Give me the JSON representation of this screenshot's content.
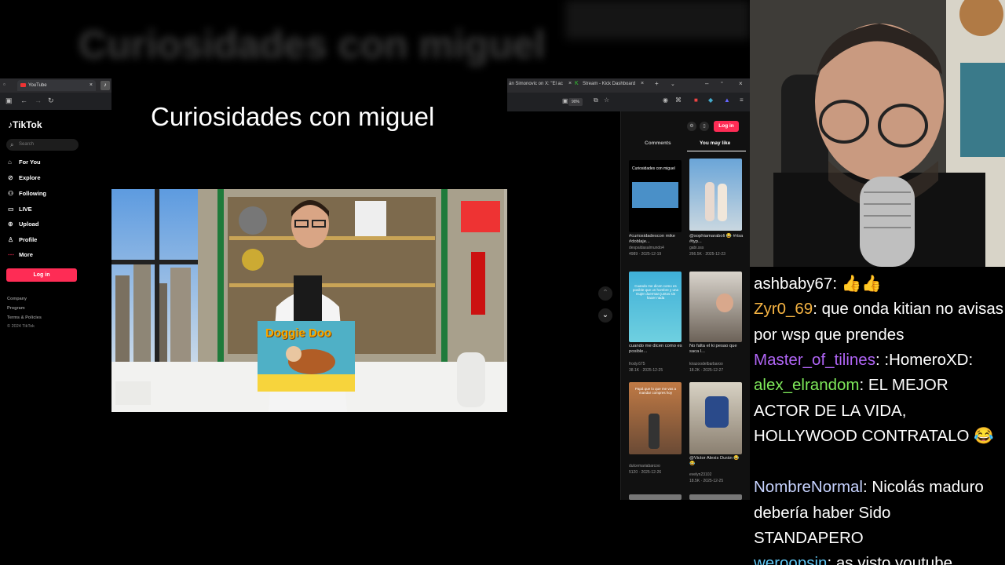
{
  "background_title": "Curiosidades con miguel",
  "left_browser": {
    "tab_label": "YouTube"
  },
  "tiktok": {
    "logo": "TikTok",
    "search_placeholder": "Search",
    "nav": [
      {
        "label": "For You",
        "icon": "home-icon"
      },
      {
        "label": "Explore",
        "icon": "compass-icon"
      },
      {
        "label": "Following",
        "icon": "users-icon"
      },
      {
        "label": "LIVE",
        "icon": "live-icon"
      },
      {
        "label": "Upload",
        "icon": "upload-icon"
      },
      {
        "label": "Profile",
        "icon": "user-icon"
      },
      {
        "label": "More",
        "icon": "more-icon"
      }
    ],
    "login": "Log in",
    "footer": [
      "Company",
      "Program",
      "Terms & Policies",
      "© 2024 TikTok"
    ]
  },
  "main": {
    "title": "Curiosidades con miguel",
    "box_title": "Doggie Doo"
  },
  "right_browser": {
    "tab1": "án Simonovic on X: \"El ac",
    "tab2": "Stream - Kick Dashboard",
    "zoom": "90%"
  },
  "side_panel": {
    "login": "Log in",
    "tabs": [
      "Comments",
      "You may like"
    ],
    "videos": [
      {
        "caption": "#curiosidadescon mike #doblaje...",
        "user": "despaldasalmundo4",
        "views": "4989",
        "date": "2025-12-19",
        "thumb_text": "Curiosidades con miguel"
      },
      {
        "caption": "@sophiamaraboli 😂 #risa #typ...",
        "user": "gabi.sss",
        "views": "266.5K",
        "date": "2025-12-23",
        "thumb_text": ""
      },
      {
        "caption": "cuando me dicen como es posible...",
        "user": "frody.675",
        "views": "38.1K",
        "date": "2025-12-25",
        "thumb_text": "Cuando me dicen como es posible que un hombre y una mujer duerman juntos sin hacer nada"
      },
      {
        "caption": "No falta el ki pesao que saca l...",
        "user": "kirazoodelbarbaroo",
        "views": "18.2K",
        "date": "2025-12-27",
        "thumb_text": ""
      },
      {
        "caption": "",
        "user": "dulcemariabarcoo",
        "views": "5120",
        "date": "2025-12-26",
        "thumb_text": "Papá que lo que me vas a mandar compres hoy"
      },
      {
        "caption": "@Victor Alexis Durán 😂😂",
        "user": "evelyn23102",
        "views": "18.5K",
        "date": "2025-12-25",
        "thumb_text": ""
      }
    ]
  },
  "chat": [
    {
      "user": "ashbaby67",
      "color": "#ffffff",
      "message": "👍👍"
    },
    {
      "user": "Zyr0_69",
      "color": "#f5b342",
      "message": "que onda kitian no avisas por wsp que prendes"
    },
    {
      "user": "Master_of_tilines",
      "color": "#b065f5",
      "message": ":HomeroXD:"
    },
    {
      "user": "alex_elrandom",
      "color": "#7ee85a",
      "message": "EL MEJOR ACTOR DE LA VIDA, HOLLYWOOD CONTRATALO 😂"
    },
    {
      "user": "NombreNormal",
      "color": "#c7d3ff",
      "message": "Nicolás maduro debería haber Sido STANDAPERO"
    },
    {
      "user": "weroopsin",
      "color": "#5fc7f5",
      "message": "as visto youtube"
    }
  ],
  "colors": {
    "tiktok_red": "#fe2c55",
    "background": "#000000"
  }
}
